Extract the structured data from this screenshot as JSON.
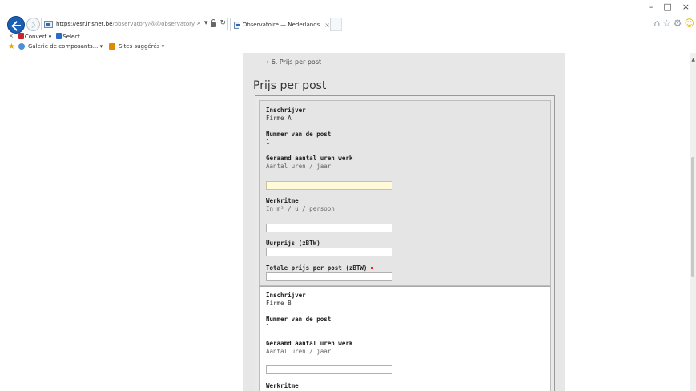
{
  "browser": {
    "url_main": "https://esr.irisnet.be",
    "url_rest": "/observatory/@@observatory",
    "tab_title": "Observatoire — Nederlands",
    "tab_close": "×",
    "window_controls": [
      "–",
      "□",
      "×"
    ],
    "right_icons": [
      "⌂",
      "☆",
      "⚙",
      "☺"
    ],
    "menu": {
      "close": "×",
      "convert_label": "Convert",
      "convert_caret": "▾",
      "select_label": "Select"
    },
    "favorites": {
      "gallery_label": "Galerie de composants...",
      "gallery_caret": "▾",
      "suggested_label": "Sites suggérés",
      "suggested_caret": "▾"
    },
    "addr_icons": {
      "search": "⌕",
      "caret": "▾",
      "refresh": "↻"
    }
  },
  "page": {
    "breadcrumb_arrow": "→",
    "breadcrumb": "6. Prijs per post",
    "title": "Prijs per post"
  },
  "entries": [
    {
      "inschrijver_label": "Inschrijver",
      "inschrijver_value": "Firme A",
      "post_label": "Nummer van de post",
      "post_value": "1",
      "uren_label": "Geraamd aantal uren werk",
      "uren_hint": "Aantal uren / jaar",
      "uren_value": "",
      "werkritme_label": "Werkritme",
      "werkritme_hint": "In m² / u / persoon",
      "werkritme_value": "",
      "uurprijs_label": "Uurprijs (zBTW)",
      "uurprijs_value": "",
      "totale_label": "Totale prijs per post (zBTW)",
      "totale_value": ""
    },
    {
      "inschrijver_label": "Inschrijver",
      "inschrijver_value": "Firme B",
      "post_label": "Nummer van de post",
      "post_value": "1",
      "uren_label": "Geraamd aantal uren werk",
      "uren_hint": "Aantal uren / jaar",
      "uren_value": "",
      "werkritme_label": "Werkritme"
    }
  ],
  "colors": {
    "content_bg": "#e7e7e7",
    "active_field": "#fffbd9",
    "required_marker": "#ee2222",
    "breadcrumb_arrow": "#3c66c0"
  }
}
